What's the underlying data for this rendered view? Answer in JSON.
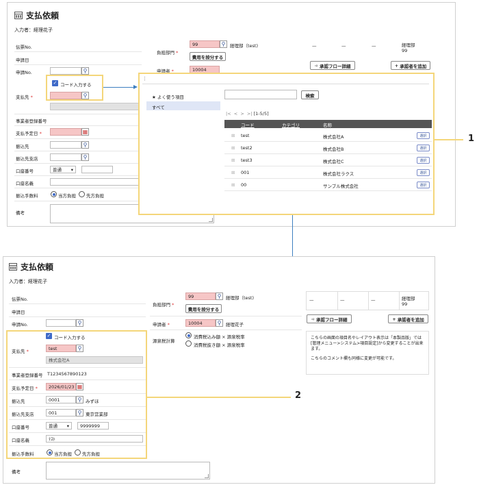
{
  "title": "支払依頼",
  "entrant": "入力者：経理花子",
  "labels": {
    "voucher_no": "伝票No.",
    "apply_date": "申請日",
    "apply_no": "申請No.",
    "payee": "支払先",
    "reg_no": "事業者登録番号",
    "pay_date": "支払予定日",
    "bank": "振込先",
    "branch": "振込先支店",
    "account_no": "口座番号",
    "account_name": "口座名義",
    "fee": "振込手数料",
    "note": "備考",
    "burden_dept": "負担部門",
    "applicant": "申請者",
    "withholding": "源泉税計算"
  },
  "code_input_label": "コード入力する",
  "dept_code": "99",
  "dept_name": "経理部（test)",
  "allocate_button": "費用を按分する",
  "applicant_code": "10004",
  "applicant_name": "経理花子",
  "withholding_options": [
    "消費税込み額 × 源泉税率",
    "消費税抜き額 × 源泉税率"
  ],
  "account_type": "普通",
  "fee_options": [
    "当方負担",
    "先方負担"
  ],
  "approval_flow_button": "承認フロー詳細",
  "add_approver_button": "承認者を追加",
  "approval_cells": [
    "—",
    "—",
    "—"
  ],
  "approval_last": [
    "経理部",
    "99"
  ],
  "info_text": "こちらの画面の項目名やレイアウト表示は「本製品版」では[管理メニュー>システム>項目設定]から変更することが出来ます。",
  "info_text2": "こちらのコメント欄も同様に変更が可能です。",
  "popup": {
    "favorites": "よく使う項目",
    "all": "すべて",
    "search_button": "検索",
    "pager": "[1-5/5]",
    "headers": [
      "コード",
      "カテゴリ",
      "名称"
    ],
    "rows": [
      {
        "code": "test",
        "name": "株式会社A"
      },
      {
        "code": "test2",
        "name": "株式会社B"
      },
      {
        "code": "test3",
        "name": "株式会社C"
      },
      {
        "code": "001",
        "name": "株式会社ラクス"
      },
      {
        "code": "00",
        "name": "サンプル株式会社"
      }
    ],
    "select_label": "選択"
  },
  "filled": {
    "payee_code": "test",
    "payee_name": "株式会社A",
    "reg_no": "T1234567890123",
    "pay_date": "2026/01/23",
    "bank_code": "0001",
    "bank_name": "みずほ",
    "branch_code": "001",
    "branch_name": "東京営業部",
    "account_no": "9999999",
    "account_name": "ﾃｽﾄ"
  },
  "callouts": [
    "1",
    "2"
  ]
}
